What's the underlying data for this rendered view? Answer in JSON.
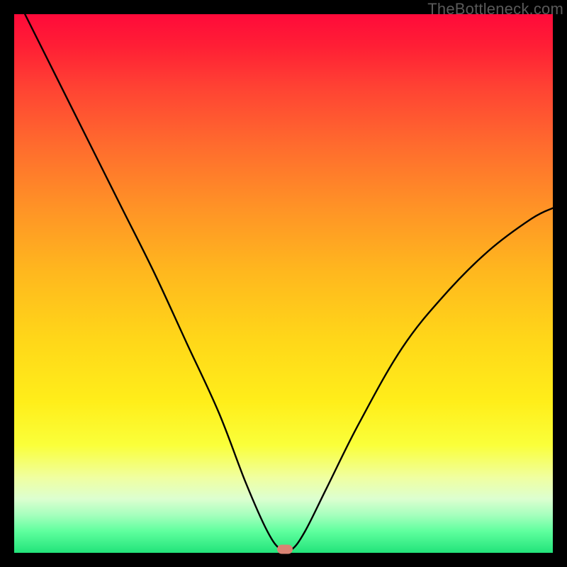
{
  "attribution": "TheBottleneck.com",
  "chart_data": {
    "type": "line",
    "title": "",
    "xlabel": "",
    "ylabel": "",
    "xlim": [
      0,
      100
    ],
    "ylim": [
      0,
      100
    ],
    "grid": false,
    "series": [
      {
        "name": "bottleneck-curve",
        "x": [
          2,
          8,
          14,
          20,
          26,
          32,
          38,
          43,
          47,
          49.5,
          51.5,
          54,
          58,
          64,
          72,
          80,
          88,
          96,
          100
        ],
        "y": [
          100,
          88,
          76,
          64,
          52,
          39,
          26,
          13,
          4,
          0.6,
          0.6,
          4,
          12,
          24,
          38,
          48,
          56,
          62,
          64
        ]
      }
    ],
    "marker": {
      "x": 50.3,
      "y": 0.6,
      "color": "#d98373"
    },
    "background_gradient": {
      "stops": [
        {
          "pos": 0,
          "color": "#ff0a3a"
        },
        {
          "pos": 100,
          "color": "#22e37a"
        }
      ]
    }
  }
}
